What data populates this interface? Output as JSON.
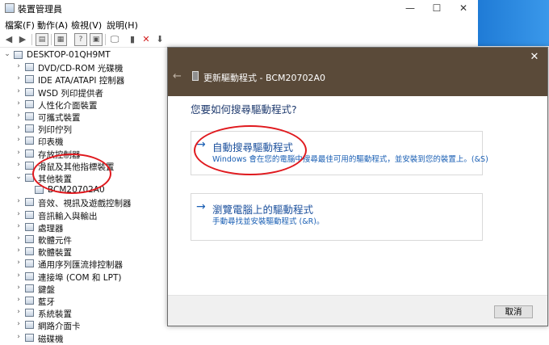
{
  "window": {
    "title": "裝置管理員",
    "menu": [
      "檔案(F)",
      "動作(A)",
      "檢視(V)",
      "說明(H)"
    ]
  },
  "tree": {
    "root": "DESKTOP-01QH9MT",
    "items": [
      "DVD/CD-ROM 光碟機",
      "IDE ATA/ATAPI 控制器",
      "WSD 列印提供者",
      "人性化介面裝置",
      "可攜式裝置",
      "列印佇列",
      "印表機",
      "存放控制器",
      "滑鼠及其他指標裝置",
      "其他裝置",
      "BCM20702A0",
      "音效、視訊及遊戲控制器",
      "音訊輸入與輸出",
      "處理器",
      "軟體元件",
      "軟體裝置",
      "通用序列匯流排控制器",
      "連接埠 (COM 和 LPT)",
      "鍵盤",
      "藍牙",
      "系統裝置",
      "網路介面卡",
      "磁碟機"
    ]
  },
  "dialog": {
    "title": "更新驅動程式 - BCM20702A0",
    "question": "您要如何搜尋驅動程式?",
    "option_auto": {
      "title": "自動搜尋驅動程式",
      "desc": "Windows 會在您的電腦中搜尋最佳可用的驅動程式，並安裝到您的裝置上。(&S)"
    },
    "option_browse": {
      "title": "瀏覽電腦上的驅動程式",
      "desc": "手動尋找並安裝驅動程式 (&R)。"
    },
    "cancel": "取消"
  },
  "icons": {
    "close": "close-icon",
    "back": "back-arrow-icon",
    "option_arrow": "arrow-right-icon"
  },
  "colors": {
    "dialog_header": "#5a4a39",
    "link_blue": "#1a4f9c",
    "annotation_red": "#e0191e"
  }
}
